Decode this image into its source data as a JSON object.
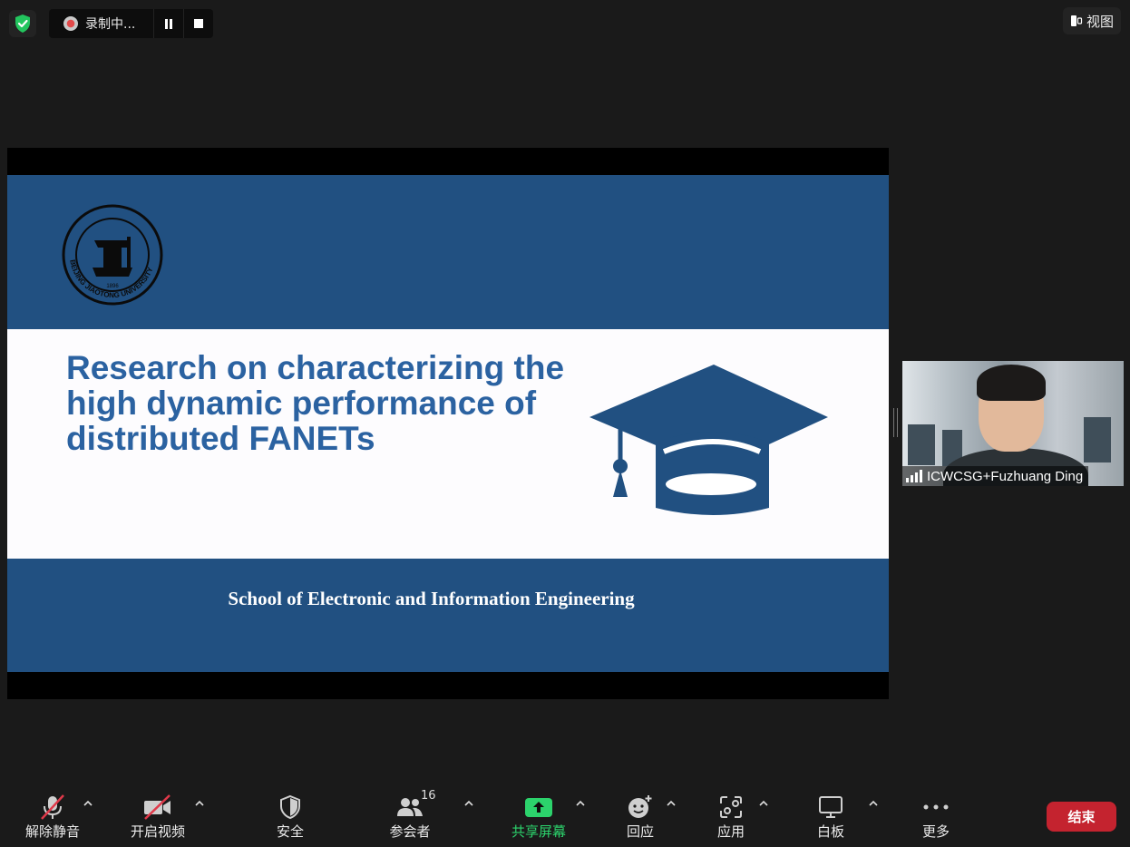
{
  "top_bar": {
    "recording_label": "录制中...",
    "view_label": "视图"
  },
  "slide": {
    "title_lines": [
      "Research on characterizing the",
      "high dynamic performance of",
      "distributed FANETs"
    ],
    "subtitle": "School of Electronic and Information Engineering",
    "logo_text": "BEIJING JIAOTONG UNIVERSITY",
    "logo_year": "1896",
    "colors": {
      "band": "#215081",
      "title": "#2b62a1",
      "middle": "#fdfcfe"
    }
  },
  "participant": {
    "name": "ICWCSG+Fuzhuang Ding"
  },
  "toolbar": {
    "mute": "解除静音",
    "video": "开启视频",
    "security": "安全",
    "participants": "参会者",
    "participants_count": "16",
    "share": "共享屏幕",
    "reactions": "回应",
    "apps": "应用",
    "whiteboard": "白板",
    "more": "更多",
    "end": "结束",
    "share_color": "#2cd36c",
    "end_color": "#c4232f"
  }
}
